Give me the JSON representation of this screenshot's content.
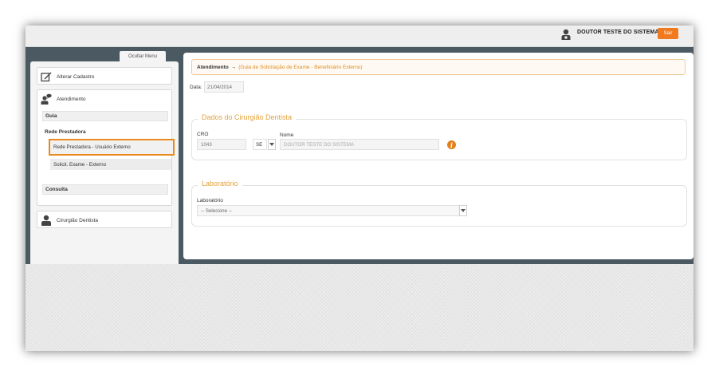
{
  "header": {
    "user_name": "DOUTOR TESTE DO SISTEMA",
    "logout_label": "Sair",
    "user_icon": "user-icon"
  },
  "sidebar": {
    "toggle_label": "Ocultar Menu",
    "alterar_cadastro": {
      "label": "Alterar Cadastro",
      "icon": "edit-icon"
    },
    "atendimento": {
      "label": "Atendimento",
      "icon": "user-chat-icon",
      "sections": {
        "guia": "Guia",
        "rede_prestadora": "Rede Prestadora",
        "consulta": "Consulta"
      },
      "items": [
        {
          "label": "Rede Prestadora - Usuário Externo",
          "active": true
        },
        {
          "label": "Solicit. Exame - Externo",
          "active": false
        }
      ]
    },
    "cirurgiao": {
      "label": "Cirurgião Dentista",
      "icon": "user-icon"
    }
  },
  "content": {
    "breadcrumb": {
      "main": "Atendimento",
      "separator": "→",
      "sub": "(Guia de Solicitação de Exame - Beneficiário Externo)"
    },
    "data_label": "Data:",
    "data_value": "21/04/2014",
    "dados": {
      "legend": "Dados do Cirurgião Dentista",
      "cro_label": "CRO",
      "cro_value": "1043",
      "uf_value": "SE",
      "nome_label": "Nome",
      "nome_value": "DOUTOR TESTE DO SISTEMA"
    },
    "laboratorio": {
      "legend": "Laboratório",
      "label": "Laboratório",
      "placeholder": "-- Selecione --"
    }
  },
  "colors": {
    "accent": "#f07a1d",
    "main_bg": "#4b5962",
    "legend": "#e3a33c"
  }
}
